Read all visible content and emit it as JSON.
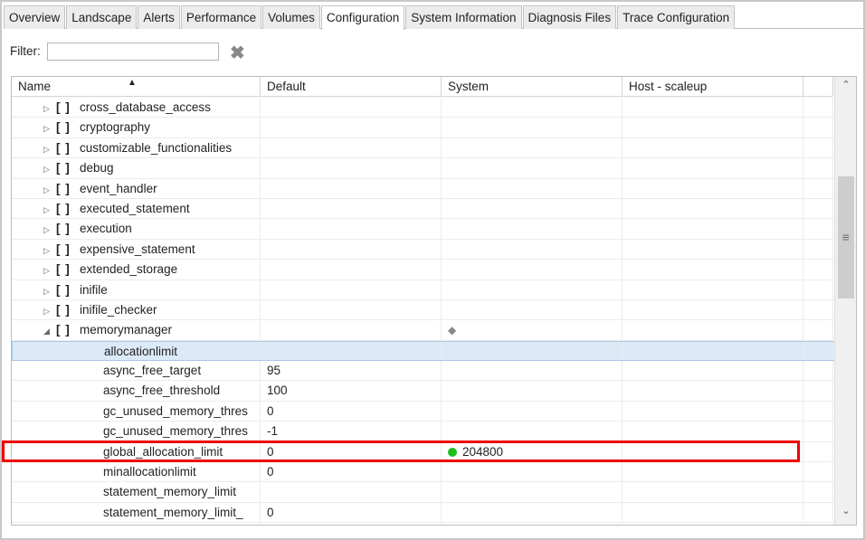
{
  "tabs": [
    "Overview",
    "Landscape",
    "Alerts",
    "Performance",
    "Volumes",
    "Configuration",
    "System Information",
    "Diagnosis Files",
    "Trace Configuration"
  ],
  "active_tab": "Configuration",
  "filter": {
    "label": "Filter:",
    "value": ""
  },
  "columns": [
    "Name",
    "Default",
    "System",
    "Host - scaleup"
  ],
  "rows": [
    {
      "name": "cross_database_access",
      "type": "section",
      "expanded": false,
      "default": "",
      "system": "",
      "host": ""
    },
    {
      "name": "cryptography",
      "type": "section",
      "expanded": false,
      "default": "",
      "system": "",
      "host": ""
    },
    {
      "name": "customizable_functionalities",
      "type": "section",
      "expanded": false,
      "default": "",
      "system": "",
      "host": ""
    },
    {
      "name": "debug",
      "type": "section",
      "expanded": false,
      "default": "",
      "system": "",
      "host": ""
    },
    {
      "name": "event_handler",
      "type": "section",
      "expanded": false,
      "default": "",
      "system": "",
      "host": ""
    },
    {
      "name": "executed_statement",
      "type": "section",
      "expanded": false,
      "default": "",
      "system": "",
      "host": ""
    },
    {
      "name": "execution",
      "type": "section",
      "expanded": false,
      "default": "",
      "system": "",
      "host": ""
    },
    {
      "name": "expensive_statement",
      "type": "section",
      "expanded": false,
      "default": "",
      "system": "",
      "host": ""
    },
    {
      "name": "extended_storage",
      "type": "section",
      "expanded": false,
      "default": "",
      "system": "",
      "host": ""
    },
    {
      "name": "inifile",
      "type": "section",
      "expanded": false,
      "default": "",
      "system": "",
      "host": ""
    },
    {
      "name": "inifile_checker",
      "type": "section",
      "expanded": false,
      "default": "",
      "system": "",
      "host": ""
    },
    {
      "name": "memorymanager",
      "type": "section",
      "expanded": true,
      "default": "",
      "system": "",
      "host": "",
      "system_marker": "diamond"
    },
    {
      "name": "allocationlimit",
      "type": "param",
      "default": "",
      "system": "",
      "host": "",
      "selected": true
    },
    {
      "name": "async_free_target",
      "type": "param",
      "default": "95",
      "system": "",
      "host": ""
    },
    {
      "name": "async_free_threshold",
      "type": "param",
      "default": "100",
      "system": "",
      "host": ""
    },
    {
      "name": "gc_unused_memory_thres",
      "type": "param",
      "default": "0",
      "system": "",
      "host": ""
    },
    {
      "name": "gc_unused_memory_thres",
      "type": "param",
      "default": "-1",
      "system": "",
      "host": ""
    },
    {
      "name": "global_allocation_limit",
      "type": "param",
      "default": "0",
      "system": "204800",
      "host": "",
      "system_marker": "green-dot",
      "highlighted": true
    },
    {
      "name": "minallocationlimit",
      "type": "param",
      "default": "0",
      "system": "",
      "host": ""
    },
    {
      "name": "statement_memory_limit",
      "type": "param",
      "default": "",
      "system": "",
      "host": ""
    },
    {
      "name": "statement_memory_limit_",
      "type": "param",
      "default": "0",
      "system": "",
      "host": ""
    }
  ],
  "section_bracket": "[ ]",
  "colors": {
    "highlight": "#ee0000",
    "selected": "#dceaf8",
    "set_value": "#1ec01e"
  }
}
